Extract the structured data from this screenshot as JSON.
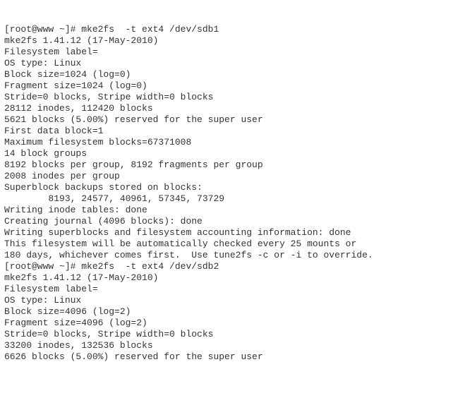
{
  "lines": [
    "[root@www ~]# mke2fs  -t ext4 /dev/sdb1",
    "mke2fs 1.41.12 (17-May-2010)",
    "Filesystem label=",
    "OS type: Linux",
    "Block size=1024 (log=0)",
    "Fragment size=1024 (log=0)",
    "Stride=0 blocks, Stripe width=0 blocks",
    "28112 inodes, 112420 blocks",
    "5621 blocks (5.00%) reserved for the super user",
    "First data block=1",
    "Maximum filesystem blocks=67371008",
    "14 block groups",
    "8192 blocks per group, 8192 fragments per group",
    "2008 inodes per group",
    "Superblock backups stored on blocks:",
    "        8193, 24577, 40961, 57345, 73729",
    "",
    "Writing inode tables: done",
    "Creating journal (4096 blocks): done",
    "Writing superblocks and filesystem accounting information: done",
    "",
    "This filesystem will be automatically checked every 25 mounts or",
    "180 days, whichever comes first.  Use tune2fs -c or -i to override.",
    "[root@www ~]# mke2fs  -t ext4 /dev/sdb2",
    "mke2fs 1.41.12 (17-May-2010)",
    "Filesystem label=",
    "OS type: Linux",
    "Block size=4096 (log=2)",
    "Fragment size=4096 (log=2)",
    "Stride=0 blocks, Stripe width=0 blocks",
    "33200 inodes, 132536 blocks",
    "6626 blocks (5.00%) reserved for the super user"
  ]
}
